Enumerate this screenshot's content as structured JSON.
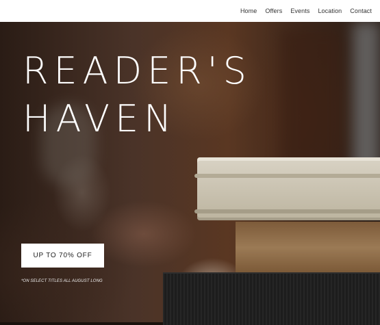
{
  "nav": {
    "items": [
      {
        "label": "Home"
      },
      {
        "label": "Offers"
      },
      {
        "label": "Events"
      },
      {
        "label": "Location"
      },
      {
        "label": "Contact"
      }
    ]
  },
  "hero": {
    "title_line1": "READER'S",
    "title_line2": "HAVEN",
    "cta_label": "UP TO 70% OFF",
    "fine_print": "*ON SELECT TITLES ALL AUGUST LONG"
  }
}
